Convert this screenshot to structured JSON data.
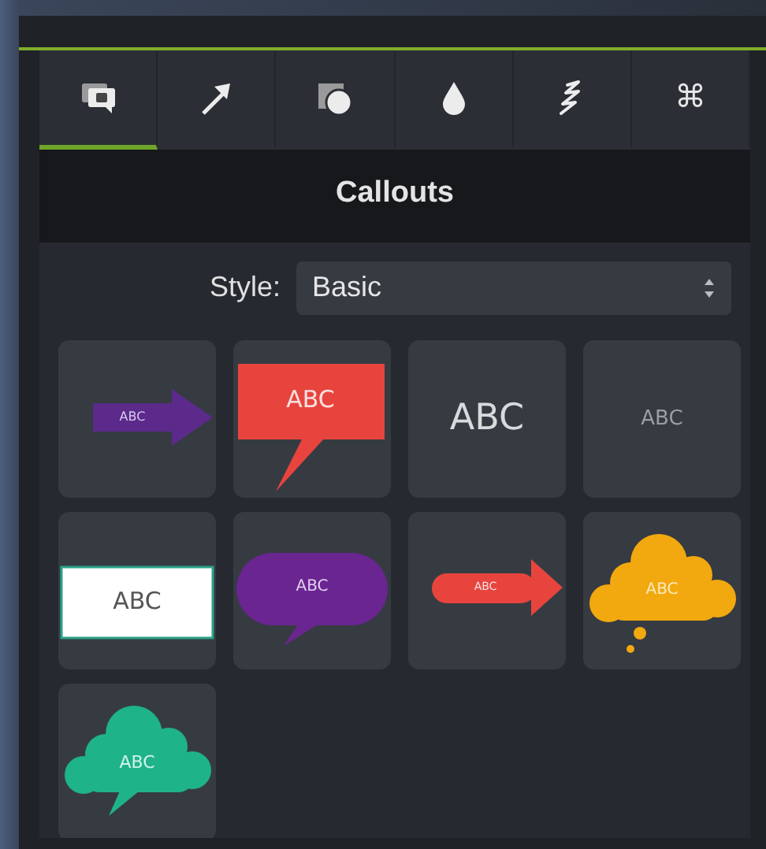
{
  "tabs": [
    {
      "kind": "callout",
      "selected": true
    },
    {
      "kind": "arrow",
      "selected": false
    },
    {
      "kind": "shape",
      "selected": false
    },
    {
      "kind": "drop",
      "selected": false
    },
    {
      "kind": "squiggle",
      "selected": false
    },
    {
      "kind": "glyph",
      "glyph": "⌘",
      "selected": false
    }
  ],
  "panel": {
    "title": "Callouts"
  },
  "style": {
    "label": "Style:",
    "value": "Basic"
  },
  "callouts": [
    {
      "kind": "arrow",
      "color": "#5b2a8a",
      "text": "ABC"
    },
    {
      "kind": "speech-rect",
      "color": "#e8443e",
      "text": "ABC"
    },
    {
      "kind": "text",
      "color": "#d8dadc",
      "text": "ABC"
    },
    {
      "kind": "text-small",
      "color": "#9a9ea3",
      "text": "ABC"
    },
    {
      "kind": "box",
      "color": "#ffffff",
      "text": "ABC"
    },
    {
      "kind": "speech-oval",
      "color": "#6a2590",
      "text": "ABC"
    },
    {
      "kind": "arrow-rounded",
      "color": "#e8443e",
      "text": "ABC"
    },
    {
      "kind": "thought-cloud",
      "color": "#f2a80f",
      "text": "ABC"
    },
    {
      "kind": "speech-cloud",
      "color": "#1fb38a",
      "text": "ABC"
    }
  ]
}
